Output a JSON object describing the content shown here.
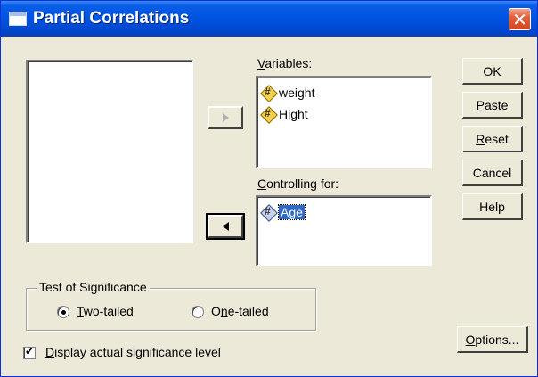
{
  "window": {
    "title": "Partial Correlations"
  },
  "variables": {
    "label_u": "V",
    "label_rest": "ariables:",
    "items": [
      "weight",
      "Hight"
    ]
  },
  "controlling": {
    "label_u": "C",
    "label_rest": "ontrolling for:",
    "items": [
      "Age"
    ],
    "selected": "Age"
  },
  "buttons": {
    "ok": "OK",
    "paste_u": "P",
    "paste_rest": "aste",
    "reset_u": "R",
    "reset_rest": "eset",
    "cancel": "Cancel",
    "help": "Help",
    "options_u": "O",
    "options_rest": "ptions..."
  },
  "significance": {
    "title": "Test of Significance",
    "two_u": "T",
    "two_rest": "wo-tailed",
    "one_pre": "O",
    "one_u": "n",
    "one_rest": "e-tailed",
    "selected": "Two-tailed"
  },
  "display_level": {
    "u": "D",
    "rest": "isplay actual significance level",
    "checked": true
  },
  "icons": {
    "window": "dialog-window-icon",
    "close": "close-icon",
    "variable": "numeric-variable-icon",
    "move_right": "arrow-right-icon",
    "move_left": "arrow-left-icon"
  }
}
